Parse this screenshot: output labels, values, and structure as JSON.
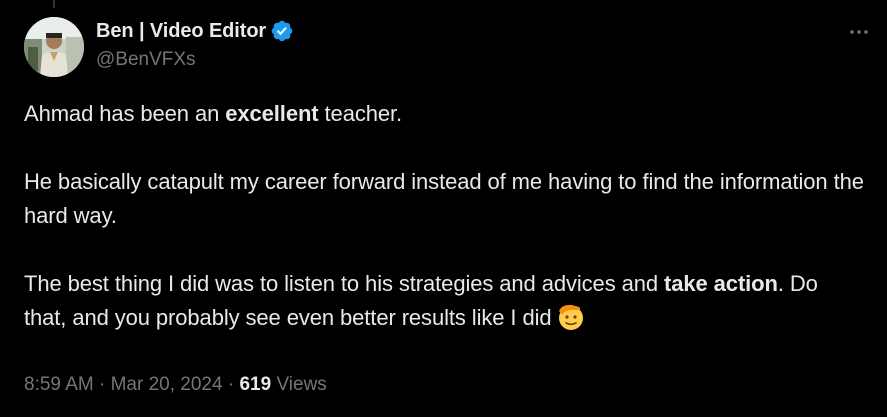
{
  "author": {
    "display_name": "Ben | Video Editor",
    "handle": "@BenVFXs",
    "verified_icon": "verified-badge-icon",
    "verified_color": "#1d9bf0"
  },
  "tweet": {
    "p1": {
      "t1": "Ahmad has been an ",
      "b1": "excellent",
      "t2": " teacher."
    },
    "p2": {
      "t1": "He basically catapult my career forward instead of me having to find the information the hard way."
    },
    "p3": {
      "t1": "The best thing I did was to listen to his strategies and advices and ",
      "b1": "take action",
      "t2": ". Do that, and you probably see even better results like I did",
      "emoji": "saluting-face-emoji"
    }
  },
  "meta": {
    "time": "8:59 AM",
    "sep1": " · ",
    "date": "Mar 20, 2024",
    "sep2": " · ",
    "views_count": "619",
    "views_label": " Views"
  },
  "colors": {
    "background": "#000000",
    "text_primary": "#e7e9ea",
    "text_secondary": "#71767b"
  }
}
